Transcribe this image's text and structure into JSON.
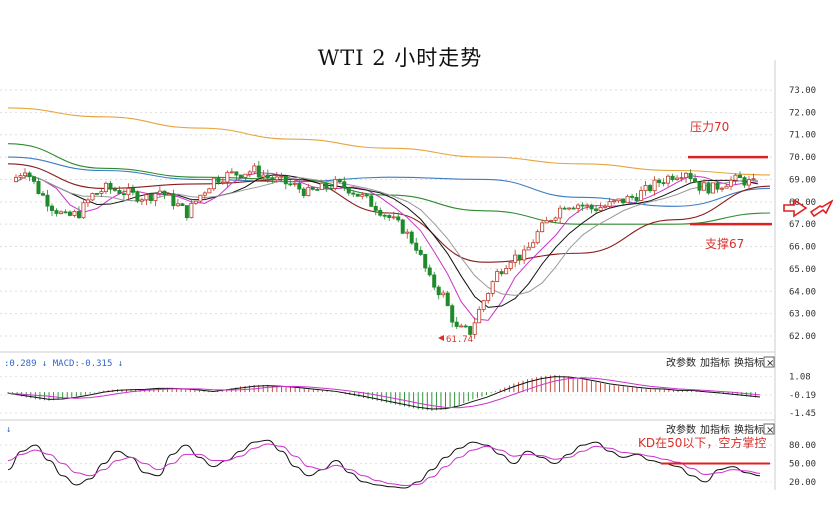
{
  "title": "WTI 2 小时走势",
  "chart_data": [
    {
      "type": "candlestick",
      "title": "WTI 2 小时走势",
      "ylim": [
        61.5,
        73.5
      ],
      "yticks": [
        "73.00",
        "72.00",
        "71.00",
        "70.00",
        "69.00",
        "68.00",
        "67.00",
        "66.00",
        "65.00",
        "64.00",
        "63.00",
        "62.00"
      ],
      "close_path": [
        68.9,
        69.5,
        68.5,
        67.8,
        67.3,
        67.5,
        68.3,
        68.6,
        68.5,
        68.3,
        68.2,
        68.5,
        68.0,
        67.5,
        68.3,
        69.0,
        69.2,
        69.3,
        69.4,
        69.1,
        68.9,
        68.7,
        68.4,
        68.6,
        68.8,
        68.6,
        68.2,
        67.8,
        67.3,
        66.8,
        66.0,
        64.5,
        63.8,
        62.3,
        62.2,
        63.6,
        64.8,
        65.5,
        65.6,
        66.6,
        67.3,
        67.9,
        67.9,
        67.7,
        67.8,
        68.0,
        68.2,
        68.5,
        68.9,
        69.2,
        69.4,
        68.7,
        68.6,
        68.9,
        69.0,
        68.8
      ],
      "moving_averages": [
        {
          "color": "#e8a33d",
          "values": [
            72.2,
            71.8,
            71.3,
            70.8,
            70.4,
            70.0,
            69.7,
            69.4,
            69.2
          ]
        },
        {
          "color": "#3b7dc4",
          "values": [
            70.0,
            69.4,
            69.0,
            68.9,
            69.1,
            69.0,
            68.2,
            67.8,
            68.6
          ]
        },
        {
          "color": "#2e8b2e",
          "values": [
            70.6,
            69.5,
            69.1,
            69.0,
            68.3,
            67.6,
            67.0,
            67.0,
            67.5
          ]
        },
        {
          "color": "#8b1a1a",
          "values": [
            69.7,
            68.6,
            68.8,
            69.0,
            67.5,
            65.3,
            65.7,
            67.2,
            68.7
          ]
        }
      ],
      "annotations": [
        {
          "text": "压力70",
          "value": 70.0
        },
        {
          "text": "支撑67",
          "value": 67.0
        },
        {
          "text": "61.74",
          "value": 61.74
        }
      ]
    },
    {
      "type": "macd",
      "legend": ":0.289 ↓ MACD:-0.315 ↓",
      "yticks": [
        "1.08",
        "-0.19",
        "-1.45"
      ],
      "ylim": [
        -1.8,
        1.4
      ],
      "histogram": [
        -0.1,
        -0.3,
        -0.5,
        -0.6,
        -0.5,
        -0.3,
        -0.1,
        0.1,
        0.2,
        0.2,
        0.2,
        0.3,
        0.3,
        0.2,
        0.1,
        0.0,
        0.2,
        0.4,
        0.5,
        0.5,
        0.4,
        0.3,
        0.2,
        0.1,
        0.0,
        -0.2,
        -0.4,
        -0.6,
        -0.8,
        -1.0,
        -1.2,
        -1.3,
        -1.2,
        -0.9,
        -0.5,
        -0.2,
        0.2,
        0.6,
        0.9,
        1.1,
        1.2,
        1.1,
        0.9,
        0.7,
        0.5,
        0.4,
        0.3,
        0.2,
        0.2,
        0.1,
        0.1,
        0.0,
        -0.1,
        -0.2,
        -0.3,
        -0.4
      ]
    },
    {
      "type": "kdj",
      "yticks": [
        "80.00",
        "50.00",
        "20.00"
      ],
      "ylim": [
        10,
        95
      ],
      "k": [
        40,
        70,
        80,
        55,
        30,
        15,
        25,
        50,
        70,
        60,
        35,
        30,
        65,
        80,
        60,
        45,
        55,
        70,
        85,
        88,
        70,
        45,
        30,
        40,
        55,
        35,
        20,
        15,
        12,
        10,
        20,
        40,
        60,
        75,
        85,
        80,
        65,
        50,
        70,
        60,
        50,
        65,
        80,
        85,
        70,
        60,
        65,
        55,
        50,
        45,
        30,
        20,
        40,
        45,
        35,
        30
      ],
      "d": [
        55,
        65,
        72,
        65,
        50,
        35,
        30,
        40,
        55,
        60,
        50,
        40,
        50,
        65,
        65,
        55,
        55,
        62,
        75,
        82,
        78,
        62,
        45,
        40,
        47,
        40,
        30,
        22,
        17,
        14,
        16,
        28,
        45,
        60,
        72,
        78,
        72,
        62,
        65,
        63,
        57,
        60,
        70,
        78,
        75,
        68,
        66,
        62,
        57,
        52,
        42,
        32,
        35,
        40,
        38,
        34
      ],
      "annotation": "KD在50以下，空方掌控",
      "annotation_value": 50
    }
  ],
  "controls": {
    "change_params": "改参数",
    "add_indicator": "加指标",
    "switch_indicator": "换指标",
    "close": "×"
  },
  "colors": {
    "up": "#c0392b",
    "down": "#1e8a2b",
    "annotation": "#d9302c",
    "k_line": "#111111",
    "d_line": "#cc33cc"
  }
}
